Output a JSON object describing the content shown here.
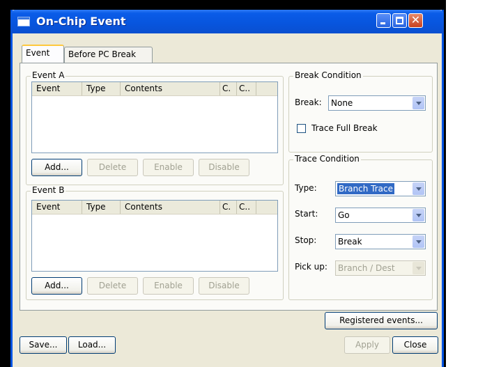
{
  "window": {
    "title": "On-Chip Event"
  },
  "tabs": [
    {
      "label": "Event"
    },
    {
      "label": "Before PC Break"
    }
  ],
  "event_a": {
    "title": "Event A",
    "columns": [
      "Event",
      "Type",
      "Contents",
      "C.",
      "C.."
    ],
    "buttons": {
      "add": "Add...",
      "delete": "Delete",
      "enable": "Enable",
      "disable": "Disable"
    }
  },
  "event_b": {
    "title": "Event B",
    "columns": [
      "Event",
      "Type",
      "Contents",
      "C.",
      "C.."
    ],
    "buttons": {
      "add": "Add...",
      "delete": "Delete",
      "enable": "Enable",
      "disable": "Disable"
    }
  },
  "break_condition": {
    "title": "Break Condition",
    "break_label": "Break:",
    "break_value": "None",
    "trace_full_break": "Trace Full Break"
  },
  "trace_condition": {
    "title": "Trace Condition",
    "type_label": "Type:",
    "type_value": "Branch Trace",
    "start_label": "Start:",
    "start_value": "Go",
    "stop_label": "Stop:",
    "stop_value": "Break",
    "pickup_label": "Pick up:",
    "pickup_value": "Branch / Dest"
  },
  "buttons": {
    "registered_events": "Registered events...",
    "save": "Save...",
    "load": "Load...",
    "apply": "Apply",
    "close": "Close"
  },
  "colors": {
    "titlebar": "#0855dd",
    "face": "#ece9d8",
    "selection": "#316ac5"
  }
}
